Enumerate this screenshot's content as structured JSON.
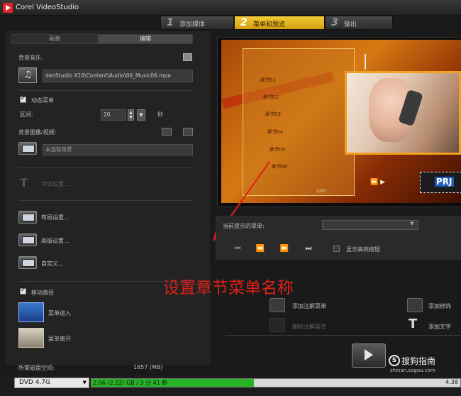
{
  "window": {
    "title": "Corel VideoStudio"
  },
  "steps": [
    {
      "num": "1",
      "label": "添加媒体"
    },
    {
      "num": "2",
      "label": "菜单和预览"
    },
    {
      "num": "3",
      "label": "输出"
    }
  ],
  "left": {
    "tabs": [
      "画廊",
      "编辑"
    ],
    "bg_music_label": "背景音乐:",
    "music_path": "deoStudio X10\\Content\\Audio\\06_Music06.mpa",
    "motion_menu_label": "动态菜单",
    "interval_label": "区间:",
    "interval_value": "20",
    "interval_unit": "秒",
    "bg_image_label": "背景图像/视频:",
    "bg_value": "未选取背景",
    "font_settings": "字体设置...",
    "layout_settings": "布局设置...",
    "advanced_settings": "高级设置...",
    "customize": "自定义...",
    "motion_path_label": "移动路径",
    "menu_in": "菜单进入",
    "menu_out": "菜单离开"
  },
  "preview": {
    "chapters": [
      "章节01",
      "章节02",
      "章节03",
      "章节04",
      "章节05",
      "章节06"
    ],
    "page_indicator": "1/10",
    "badge": "PRJ"
  },
  "controls": {
    "current_menu_label": "当前显示的菜单:",
    "show_safe_area_label": "显示高亮按钮"
  },
  "tools": {
    "add_note_menu": "添加注解菜单",
    "delete_note_menu": "删除注解菜单",
    "add_decoration": "添加修饰",
    "add_text": "添加文字"
  },
  "disk": {
    "space_label": "所需磁盘空间:",
    "space_value": "1857 (MB)",
    "selected": "DVD 4.7G",
    "usage_text": "2.06 (2.22) GB / 3 分 41 秒",
    "usage_fraction": 0.44,
    "capacity_end": "4.38"
  },
  "annotation": {
    "text": "设置章节菜单名称"
  },
  "watermark": {
    "text": "搜狗指南",
    "url": "zhinan.sogou.com",
    "logo": "S"
  },
  "colors": {
    "accent_tab": "#e2ad1c",
    "progress": "#26b326",
    "annotation": "#e0201a"
  }
}
